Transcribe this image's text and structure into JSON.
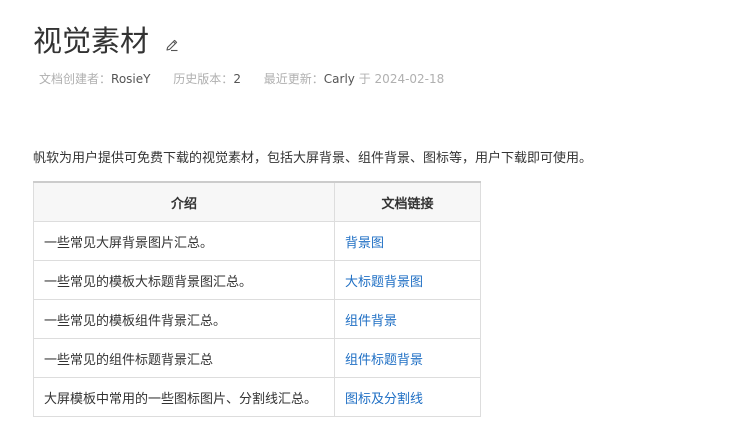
{
  "page": {
    "title": "视觉素材"
  },
  "meta": {
    "creator_label": "文档创建者：",
    "creator": "RosieY",
    "history_label": "历史版本：",
    "history_count": "2",
    "updated_label": "最近更新：",
    "updated_by": "Carly",
    "updated_sep": " 于 ",
    "updated_date": "2024-02-18"
  },
  "intro": "帆软为用户提供可免费下载的视觉素材，包括大屏背景、组件背景、图标等，用户下载即可使用。",
  "table": {
    "headers": [
      "介绍",
      "文档链接"
    ],
    "rows": [
      {
        "desc": "一些常见大屏背景图片汇总。",
        "link": "背景图"
      },
      {
        "desc": "一些常见的模板大标题背景图汇总。",
        "link": "大标题背景图"
      },
      {
        "desc": "一些常见的模板组件背景汇总。",
        "link": "组件背景"
      },
      {
        "desc": "一些常见的组件标题背景汇总",
        "link": "组件标题背景"
      },
      {
        "desc": "大屏模板中常用的一些图标图片、分割线汇总。",
        "link": "图标及分割线"
      }
    ]
  },
  "colors": {
    "link": "#1f6fc4",
    "meta": "#b0b0b0"
  },
  "icons": {
    "edit": "pencil-icon"
  }
}
